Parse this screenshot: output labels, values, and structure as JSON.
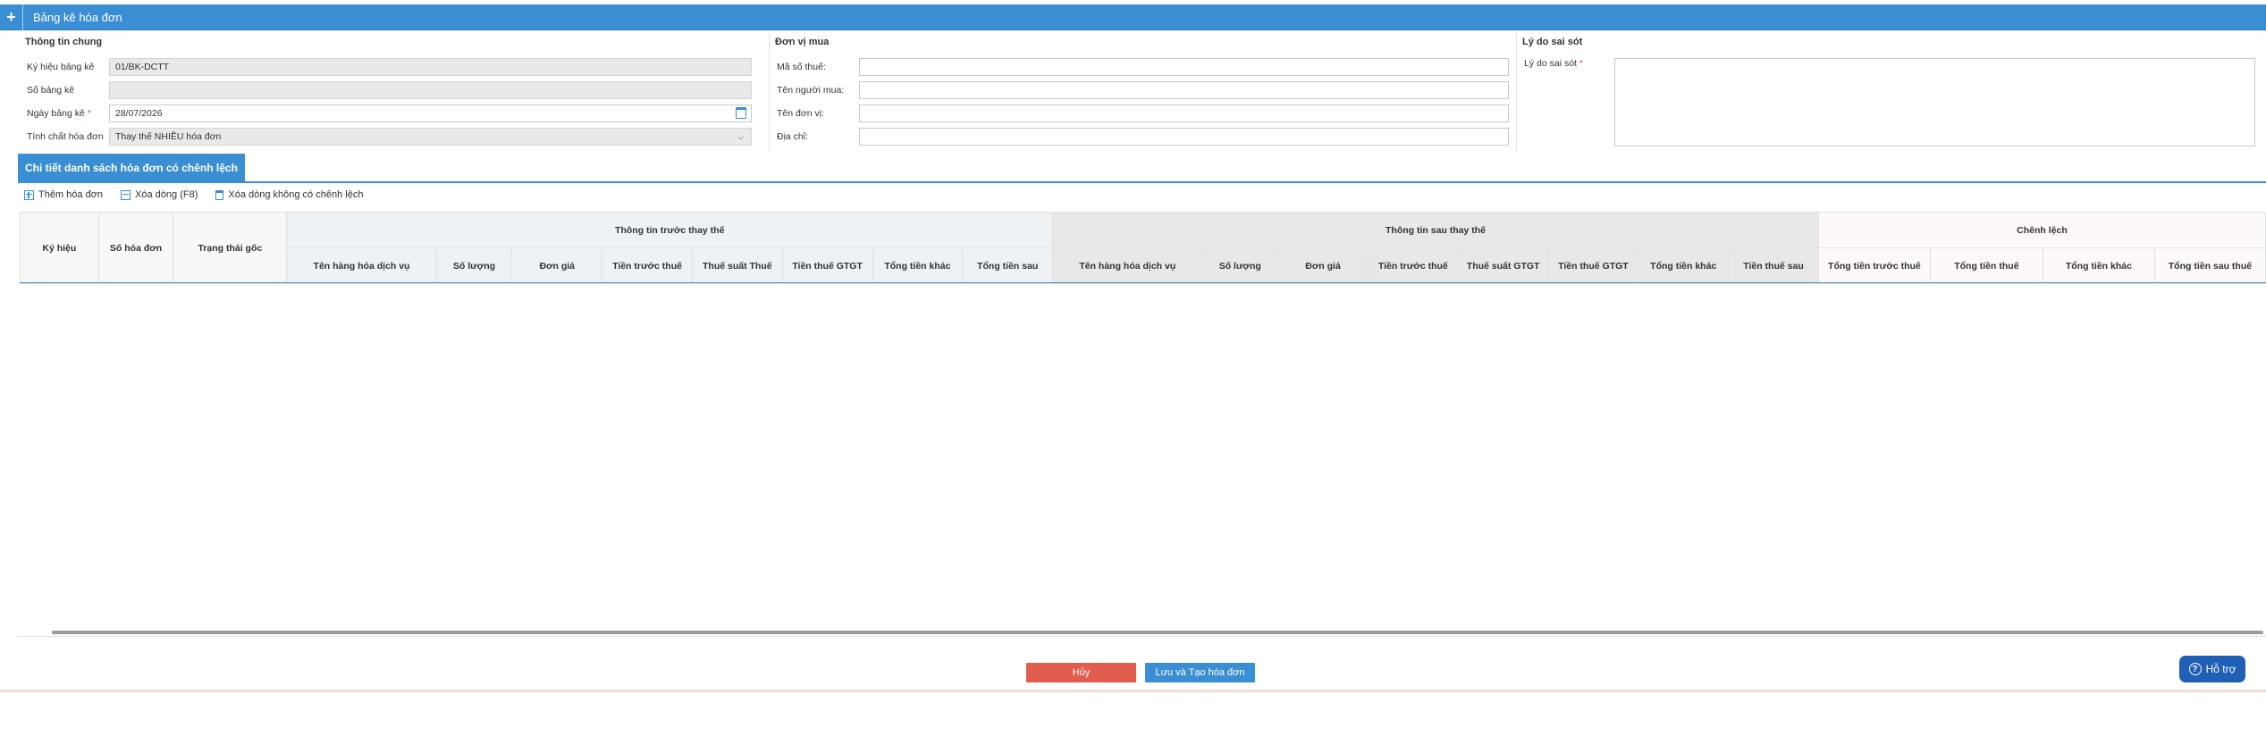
{
  "header": {
    "plus": "+",
    "title": "Bảng kê hóa đơn"
  },
  "general": {
    "title": "Thông tin chung",
    "fields": [
      {
        "label": "Ký hiệu bảng kê",
        "value": "01/BK-DCTT"
      },
      {
        "label": "Số bảng kê",
        "value": ""
      },
      {
        "label": "Ngày bảng kê",
        "required_mark": "*",
        "value": "28/07/2026"
      },
      {
        "label": "Tính chất hóa đơn",
        "value": "Thay thế NHIỀU hóa đơn"
      }
    ]
  },
  "buyer": {
    "title": "Đơn vị mua",
    "fields": [
      {
        "label": "Mã số thuế:",
        "value": ""
      },
      {
        "label": "Tên người mua:",
        "value": ""
      },
      {
        "label": "Tên đơn vị:",
        "value": ""
      },
      {
        "label": "Địa chỉ:",
        "value": ""
      }
    ]
  },
  "reason": {
    "title": "Lý do sai sót",
    "label": "Lý do sai sót",
    "required_mark": "*",
    "value": ""
  },
  "section": {
    "title": "Chi tiết danh sách hóa đơn có chênh lệch"
  },
  "toolbar": {
    "add": "Thêm hóa đơn",
    "delete": "Xóa dòng (F8)",
    "delete_no_diff": "Xóa dòng không có chênh lệch"
  },
  "grid": {
    "fixed": [
      "Ký hiệu",
      "Số hóa đơn",
      "Trạng thái gốc"
    ],
    "group_before": "Thông tin trước thay thế",
    "group_after": "Thông tin sau thay thế",
    "group_diff": "Chênh lệch",
    "before_cols": [
      "Tên hàng hóa dịch vụ",
      "Số lượng",
      "Đơn giá",
      "Tiền trước thuế",
      "Thuế suất Thuế",
      "Tiền thuế GTGT",
      "Tổng tiền khác",
      "Tổng tiền sau"
    ],
    "after_cols": [
      "Tên hàng hóa dịch vụ",
      "Số lượng",
      "Đơn giá",
      "Tiền trước thuế",
      "Thuế suất GTGT",
      "Tiền thuế GTGT",
      "Tổng tiền khác",
      "Tiền thuế sau"
    ],
    "diff_cols": [
      "Tổng tiền trước thuế",
      "Tổng tiền thuế",
      "Tổng tiền khác",
      "Tổng tiền sau thuế"
    ]
  },
  "footer": {
    "cancel": "Hủy",
    "save": "Lưu và Tạo hóa đơn",
    "help": "Hỗ trợ",
    "help_icon": "?"
  },
  "colors": {
    "primary": "#3a8ed4",
    "cancel": "#e35d4f",
    "help": "#1f5fb5"
  }
}
